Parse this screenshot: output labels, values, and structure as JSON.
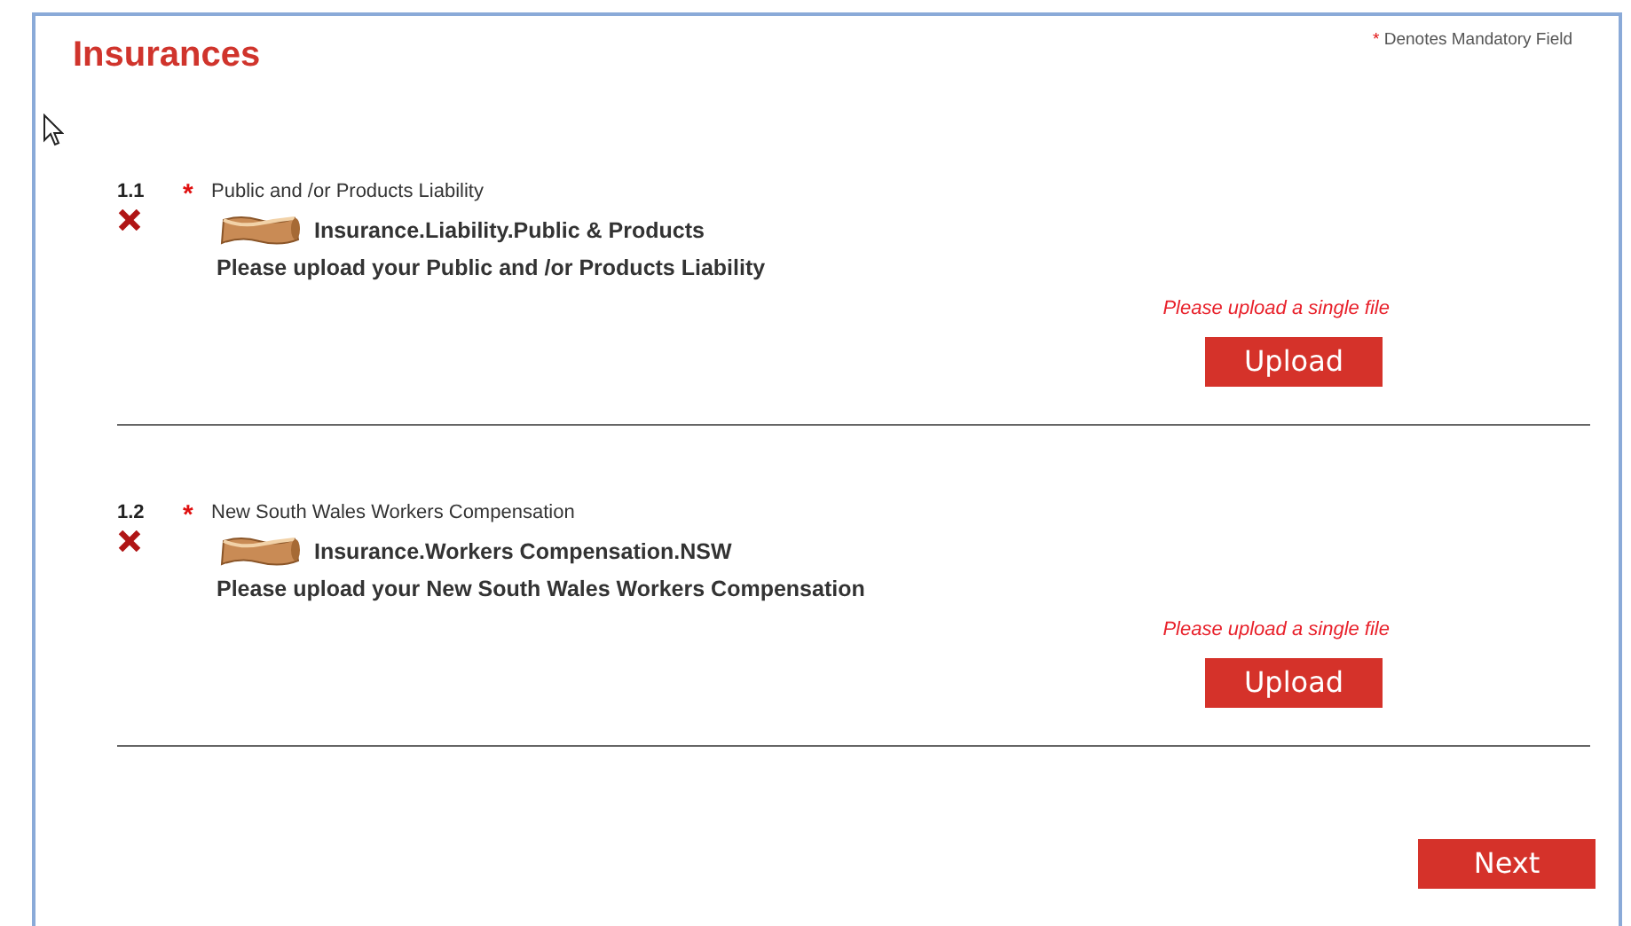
{
  "title": "Insurances",
  "mandatory_note": {
    "marker": "*",
    "text": "Denotes Mandatory Field"
  },
  "items": [
    {
      "number": "1.1",
      "required": true,
      "label": "Public and /or Products Liability",
      "complete": false,
      "document": "Insurance.Liability.Public & Products",
      "instruction": "Please upload your Public and /or Products Liability",
      "hint": "Please upload a single file",
      "button": "Upload"
    },
    {
      "number": "1.2",
      "required": true,
      "label": "New South Wales Workers Compensation",
      "complete": false,
      "document": "Insurance.Workers Compensation.NSW",
      "instruction": "Please upload your New South Wales Workers Compensation",
      "hint": "Please upload a single file",
      "button": "Upload"
    }
  ],
  "next_button": "Next"
}
